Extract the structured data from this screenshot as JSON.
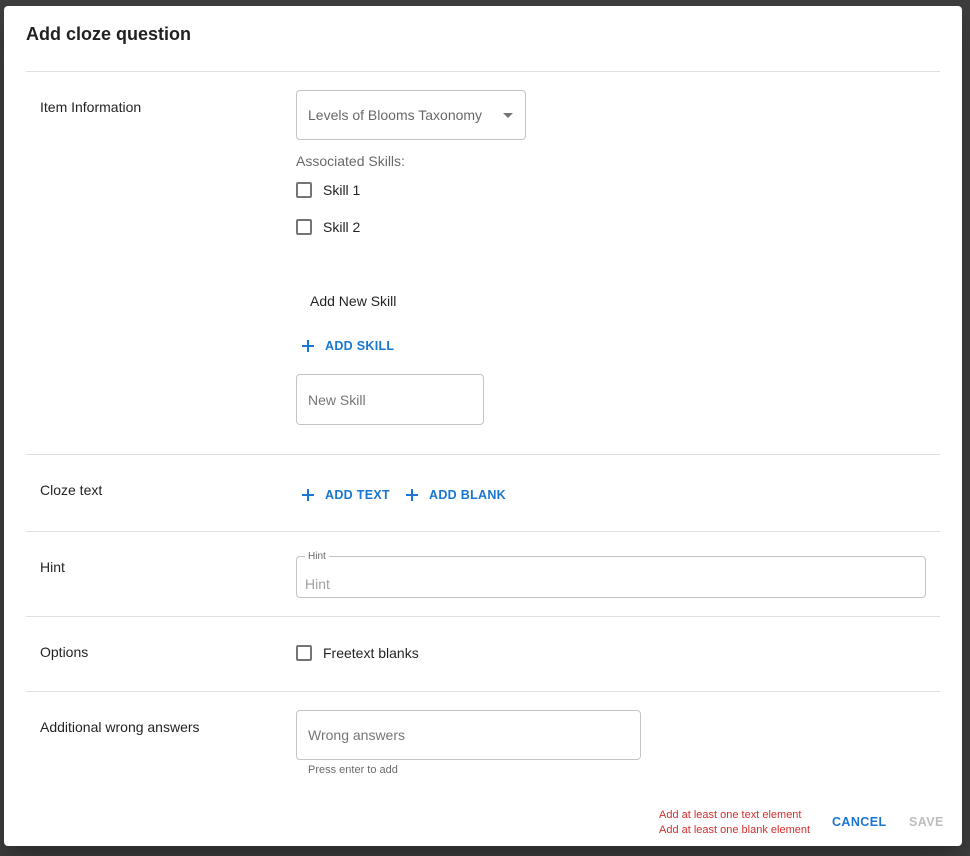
{
  "dialog": {
    "title": "Add cloze question"
  },
  "item_information": {
    "label": "Item Information",
    "taxonomy_select": {
      "value": "Levels of Blooms Taxonomy"
    },
    "associated_skills_label": "Associated Skills:",
    "skills": [
      {
        "label": "Skill 1",
        "checked": false
      },
      {
        "label": "Skill 2",
        "checked": false
      }
    ],
    "add_new_skill_label": "Add New Skill",
    "add_skill_button": "ADD SKILL",
    "new_skill_input": {
      "value": "",
      "placeholder": "New Skill"
    }
  },
  "cloze_text": {
    "label": "Cloze text",
    "add_text_button": "ADD TEXT",
    "add_blank_button": "ADD BLANK"
  },
  "hint": {
    "label": "Hint",
    "field_legend": "Hint",
    "input": {
      "value": "",
      "placeholder": "Hint"
    }
  },
  "options": {
    "label": "Options",
    "freetext_blanks": {
      "label": "Freetext blanks",
      "checked": false
    }
  },
  "wrong_answers": {
    "label": "Additional wrong answers",
    "input": {
      "value": "",
      "placeholder": "Wrong answers"
    },
    "helper": "Press enter to add"
  },
  "footer": {
    "errors": [
      "Add at least one text element",
      "Add at least one blank element"
    ],
    "cancel_label": "CANCEL",
    "save_label": "SAVE"
  },
  "colors": {
    "primary": "#1976d2",
    "error": "#d32f2f",
    "disabled": "#bdbdbd"
  }
}
